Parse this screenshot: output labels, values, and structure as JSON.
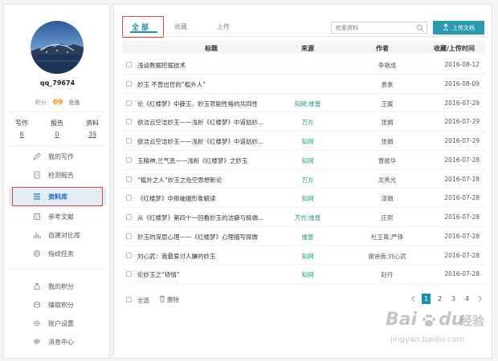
{
  "profile": {
    "username": "qq_79674",
    "points_label": "积分：",
    "points_value": "69",
    "recharge_label": "充值",
    "stats": [
      {
        "label": "写作",
        "value": "6"
      },
      {
        "label": "报告",
        "value": "0"
      },
      {
        "label": "资料",
        "value": "39"
      }
    ]
  },
  "sidebar": {
    "items": [
      {
        "label": "我的写作",
        "icon": "pencil-icon"
      },
      {
        "label": "检测报告",
        "icon": "report-icon"
      },
      {
        "label": "资料库",
        "icon": "list-icon",
        "active": true
      },
      {
        "label": "参考文献",
        "icon": "reference-icon"
      },
      {
        "label": "自建对比库",
        "icon": "bar-chart-icon"
      },
      {
        "label": "指纹任务",
        "icon": "fingerprint-icon"
      },
      {
        "label": "我的积分",
        "icon": "money-bag-icon"
      },
      {
        "label": "赚取积分",
        "icon": "coins-icon"
      },
      {
        "label": "账户设置",
        "icon": "gear-icon"
      },
      {
        "label": "消息中心",
        "icon": "chat-icon"
      }
    ]
  },
  "tabs": {
    "all": "全部",
    "favorites": "收藏",
    "uploads": "上传"
  },
  "search": {
    "placeholder": "检索资料"
  },
  "upload_button": "上传文档",
  "table": {
    "headers": {
      "title": "标题",
      "source": "来源",
      "author": "作者",
      "date": "收藏/上传时间"
    },
    "rows": [
      {
        "title": "浅谈数据挖掘技术",
        "source": "",
        "author": "李艳成",
        "date": "2016-08-12"
      },
      {
        "title": "妙玉 不曾出世的“槛外人”",
        "source": "",
        "author": "袁袁",
        "date": "2016-08-09"
      },
      {
        "title": "论《红楼梦》中薛玉、妙玉悲剧性格的共同性",
        "source": "知网;维普",
        "author": "王媛",
        "date": "2016-07-29"
      },
      {
        "title": "欲洁云空洁妙玉——浅析《红楼梦》中道姑妙...",
        "source": "万方",
        "author": "张娟",
        "date": "2016-07-29"
      },
      {
        "title": "欲洁云空洁妙玉——浅析《红楼梦》中道姑妙...",
        "source": "知网",
        "author": "张娟",
        "date": "2016-07-29"
      },
      {
        "title": "玉精神,兰气息——浅析《红楼梦》之妙玉",
        "source": "知网",
        "author": "曹振华",
        "date": "2016-07-28"
      },
      {
        "title": "“槛外之人”妙玉之色空思想新论",
        "source": "万方",
        "author": "龙秀光",
        "date": "2016-07-28"
      },
      {
        "title": "《红楼梦》中邢岫烟形象解读",
        "source": "知网",
        "author": "漆娟",
        "date": "2016-07-28"
      },
      {
        "title": "从《红楼梦》第四十一回看妙玉的洁癖与极端...",
        "source": "万方;维普",
        "author": "庄熙",
        "date": "2016-07-28"
      },
      {
        "title": "妙玉的深层心理——《红楼梦》心理描写探微",
        "source": "维普",
        "author": "杜王菁;严铮",
        "date": "2016-07-28"
      },
      {
        "title": "刘心武：我最爱讨人嫌的妙玉",
        "source": "知网",
        "author": "谢迪南;刘心武",
        "date": "2016-07-28"
      },
      {
        "title": "论妙玉之“矫情”",
        "source": "知网",
        "author": "赵丹",
        "date": "2016-07-28"
      }
    ]
  },
  "footer": {
    "select_all": "全选",
    "delete": "删除"
  },
  "pagination": {
    "pages": [
      "1",
      "2",
      "3",
      "4"
    ],
    "current": "1"
  },
  "watermark": {
    "brand": "Bai",
    "brand2": "du",
    "cn": "经验",
    "url": "jingyan.baidu.com"
  },
  "colors": {
    "accent": "#1a8fb0",
    "highlight_box": "#e8453c",
    "source_text": "#1a9a8a",
    "points": "#ff8a00"
  }
}
